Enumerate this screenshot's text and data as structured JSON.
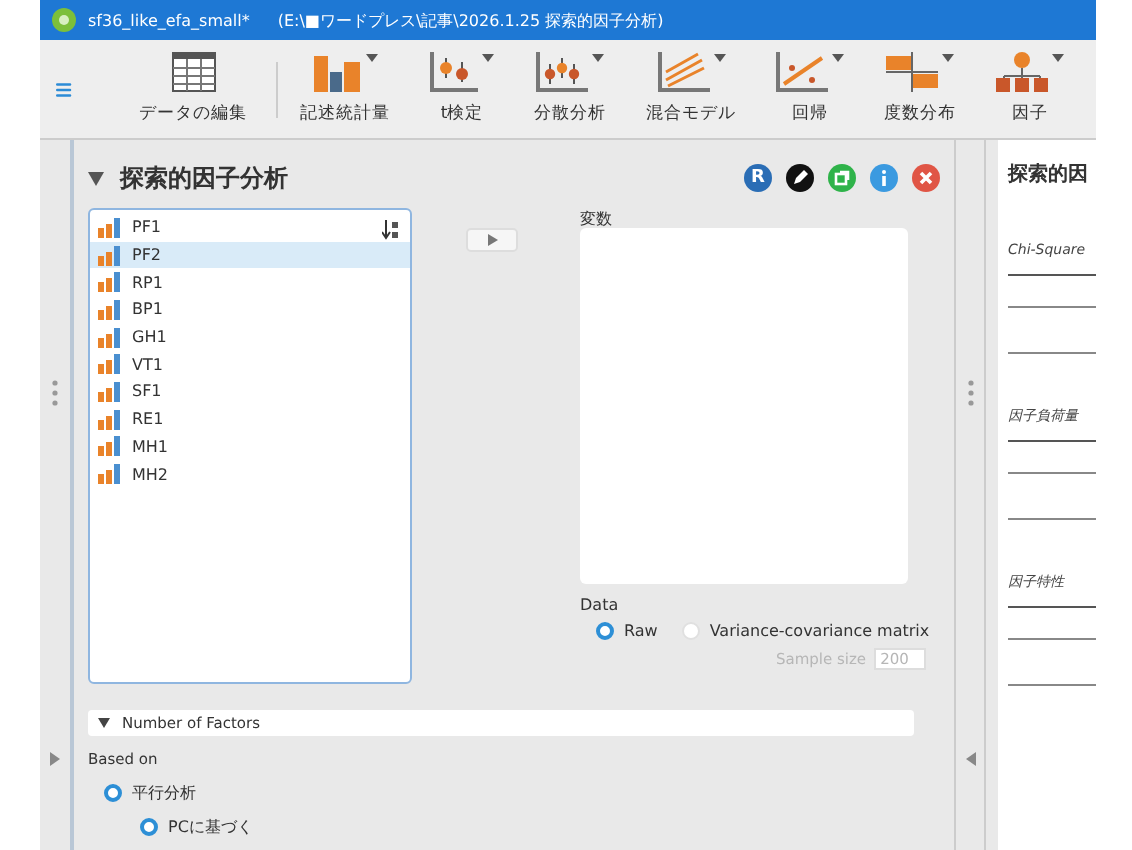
{
  "window": {
    "title": "sf36_like_efa_small*",
    "path": "(E:\\■ワードプレス\\記事\\2026.1.25 探索的因子分析)"
  },
  "toolbar": [
    {
      "label": "データの編集",
      "kind": "table",
      "menu": false
    },
    {
      "label": "記述統計量",
      "kind": "bars",
      "menu": true
    },
    {
      "label": "t検定",
      "kind": "ttest",
      "menu": true
    },
    {
      "label": "分散分析",
      "kind": "anova",
      "menu": true
    },
    {
      "label": "混合モデル",
      "kind": "mixed",
      "menu": true
    },
    {
      "label": "回帰",
      "kind": "regression",
      "menu": true
    },
    {
      "label": "度数分布",
      "kind": "frequency",
      "menu": true
    },
    {
      "label": "因子",
      "kind": "factor",
      "menu": true
    }
  ],
  "analysis": {
    "title": "探索的因子分析",
    "expanded": true,
    "header_buttons": [
      {
        "kind": "r",
        "label": "R"
      },
      {
        "kind": "edit"
      },
      {
        "kind": "duplicate"
      },
      {
        "kind": "info"
      },
      {
        "kind": "close"
      }
    ],
    "variables": [
      {
        "name": "PF1",
        "selected": false
      },
      {
        "name": "PF2",
        "selected": true
      },
      {
        "name": "RP1",
        "selected": false
      },
      {
        "name": "BP1",
        "selected": false
      },
      {
        "name": "GH1",
        "selected": false
      },
      {
        "name": "VT1",
        "selected": false
      },
      {
        "name": "SF1",
        "selected": false
      },
      {
        "name": "RE1",
        "selected": false
      },
      {
        "name": "MH1",
        "selected": false
      },
      {
        "name": "MH2",
        "selected": false
      }
    ],
    "target_label": "変数",
    "data": {
      "label": "Data",
      "options": [
        {
          "label": "Raw",
          "selected": true
        },
        {
          "label": "Variance-covariance matrix",
          "selected": false
        }
      ],
      "sample_size_label": "Sample size",
      "sample_size": "200",
      "sample_size_disabled": true
    },
    "number_of_factors": {
      "label": "Number of Factors",
      "expanded": true
    },
    "based_on": {
      "label": "Based on",
      "options": [
        {
          "label": "平行分析",
          "selected": true,
          "children": [
            {
              "label": "PCに基づく",
              "selected": true
            }
          ]
        }
      ]
    }
  },
  "results": {
    "title": "探索的因",
    "tables": [
      {
        "title": "Chi-Square"
      },
      {
        "title": "因子負荷量"
      },
      {
        "title": "因子特性"
      }
    ]
  }
}
